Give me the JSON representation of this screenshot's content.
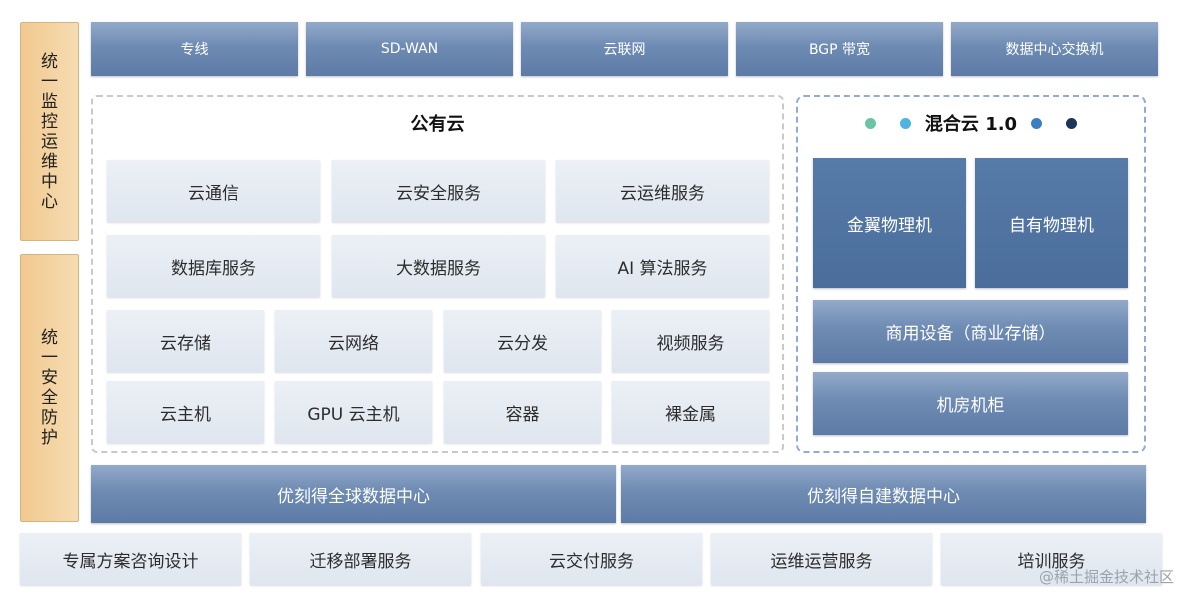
{
  "left_bars": [
    {
      "chars": [
        "统",
        "一",
        "监",
        "控",
        "运",
        "维",
        "中",
        "心"
      ]
    },
    {
      "chars": [
        "统",
        "一",
        "安",
        "全",
        "防",
        "护"
      ]
    }
  ],
  "top_row": [
    "专线",
    "SD-WAN",
    "云联网",
    "BGP 带宽",
    "数据中心交换机"
  ],
  "public_cloud": {
    "title": "公有云",
    "row1": [
      "云通信",
      "云安全服务",
      "云运维服务"
    ],
    "row2": [
      "数据库服务",
      "大数据服务",
      "AI 算法服务"
    ],
    "row3": [
      "云存储",
      "云网络",
      "云分发",
      "视频服务"
    ],
    "row4": [
      "云主机",
      "GPU 云主机",
      "容器",
      "裸金属"
    ]
  },
  "hybrid_cloud": {
    "title": "混合云 1.0",
    "dot_colors": [
      "#6cc4a6",
      "#4fb3e3",
      "#3a7fc0",
      "#1e3558"
    ],
    "machines": [
      "金翼物理机",
      "自有物理机"
    ],
    "devices": "商用设备（商业存储）",
    "rack": "机房机柜"
  },
  "datacenters": [
    "优刻得全球数据中心",
    "优刻得自建数据中心"
  ],
  "services": [
    "专属方案咨询设计",
    "迁移部署服务",
    "云交付服务",
    "运维运营服务",
    "培训服务"
  ],
  "watermark": "@稀土掘金技术社区"
}
